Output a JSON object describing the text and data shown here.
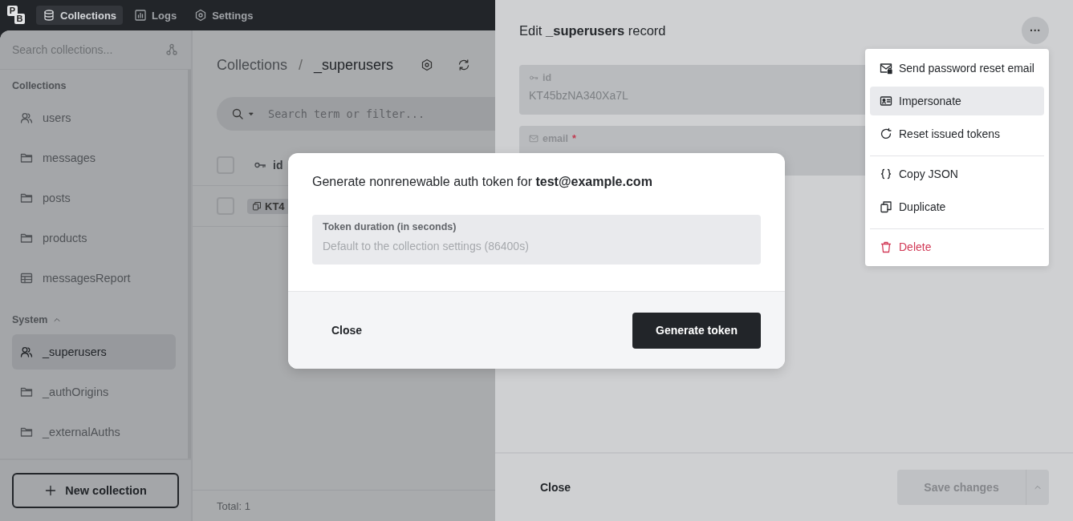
{
  "topbar": {
    "logo": [
      "P",
      "B"
    ],
    "nav": [
      {
        "label": "Collections",
        "kind": "database",
        "selected": true
      },
      {
        "label": "Logs",
        "kind": "chart",
        "selected": false
      },
      {
        "label": "Settings",
        "kind": "gear",
        "selected": false
      }
    ]
  },
  "sidebar": {
    "search": {
      "placeholder": "Search collections..."
    },
    "sections": [
      {
        "title": "Collections",
        "kind": "plain",
        "items": [
          {
            "label": "users",
            "kind": "users",
            "selected": false
          },
          {
            "label": "messages",
            "kind": "folder",
            "selected": false
          },
          {
            "label": "posts",
            "kind": "folder",
            "selected": false
          },
          {
            "label": "products",
            "kind": "folder",
            "selected": false
          },
          {
            "label": "messagesReport",
            "kind": "table",
            "selected": false
          }
        ]
      },
      {
        "title": "System",
        "kind": "collapsible",
        "expanded": true,
        "items": [
          {
            "label": "_superusers",
            "kind": "users",
            "selected": true
          },
          {
            "label": "_authOrigins",
            "kind": "folder",
            "selected": false
          },
          {
            "label": "_externalAuths",
            "kind": "folder",
            "selected": false
          }
        ]
      }
    ],
    "new_button": "New collection"
  },
  "main": {
    "breadcrumb": [
      "Collections",
      "/",
      "_superusers"
    ],
    "search": {
      "placeholder": "Search term or filter..."
    },
    "table": {
      "columns": [
        {
          "label": "id",
          "checked": false
        }
      ],
      "rows": [
        {
          "id": "KT4",
          "checked": false
        }
      ]
    },
    "total": "Total: 1"
  },
  "record_panel": {
    "title": "Edit **_superusers** record",
    "menu_button": "···",
    "fields": [
      {
        "label": "id",
        "kind": "key",
        "value": "KT45bzNA340Xa7L"
      },
      {
        "label": "email",
        "kind": "mail",
        "required_mark": "*"
      }
    ],
    "menu": [
      {
        "label": "Send password reset email",
        "kind": "mail-lock",
        "selected": false
      },
      {
        "label": "Impersonate",
        "kind": "id-card",
        "selected": true
      },
      {
        "label": "Reset issued tokens",
        "kind": "reset",
        "selected": false
      },
      {
        "kind": "divider"
      },
      {
        "label": "Copy JSON",
        "kind": "braces",
        "selected": false
      },
      {
        "label": "Duplicate",
        "kind": "copy",
        "selected": false
      },
      {
        "kind": "divider"
      },
      {
        "label": "Delete",
        "kind": "trash",
        "selected": false
      }
    ],
    "close_button": "Close",
    "save_button": {
      "label": "Save changes",
      "disabled": true
    }
  },
  "modal": {
    "title": "Generate nonrenewable auth token for **test@example.com**",
    "field": {
      "label": "Token duration (in seconds)",
      "placeholder": "Default to the collection settings (86400s)"
    },
    "close_button": "Close",
    "submit_button": "Generate token"
  }
}
